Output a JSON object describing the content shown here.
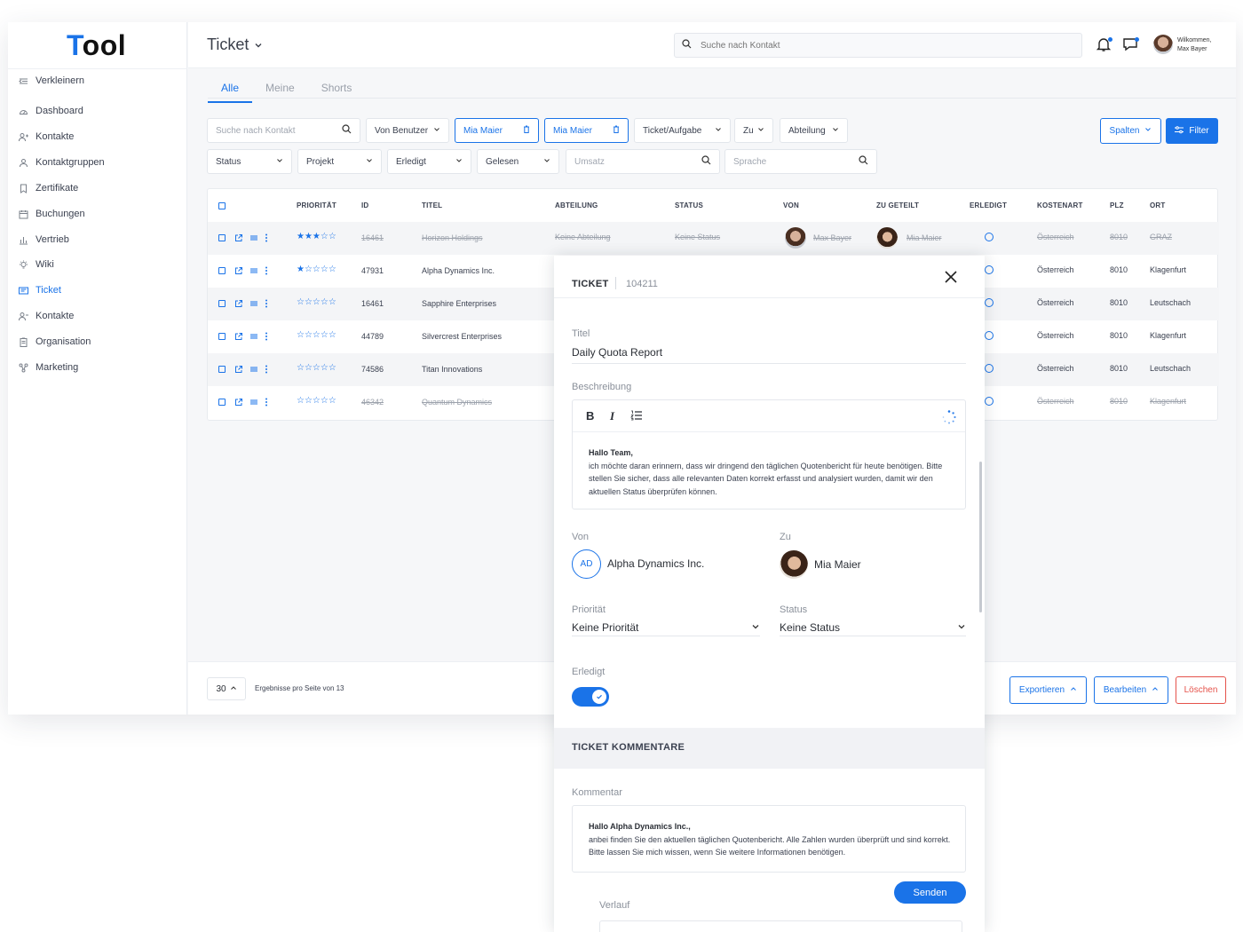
{
  "app": {
    "logo_first": "T",
    "logo_rest": "ool"
  },
  "sidebar": {
    "items": [
      {
        "label": "Verkleinern",
        "icon": "collapse-icon"
      },
      {
        "label": "Dashboard",
        "icon": "dashboard-icon"
      },
      {
        "label": "Kontakte",
        "icon": "contacts-icon"
      },
      {
        "label": "Kontaktgruppen",
        "icon": "contact-groups-icon"
      },
      {
        "label": "Zertifikate",
        "icon": "bookmark-icon"
      },
      {
        "label": "Buchungen",
        "icon": "calendar-icon"
      },
      {
        "label": "Vertrieb",
        "icon": "bar-chart-icon"
      },
      {
        "label": "Wiki",
        "icon": "lightbulb-icon"
      },
      {
        "label": "Ticket",
        "icon": "ticket-icon",
        "active": true
      },
      {
        "label": "Kontakte",
        "icon": "contacts-icon"
      },
      {
        "label": "Organisation",
        "icon": "clipboard-icon"
      },
      {
        "label": "Marketing",
        "icon": "network-icon"
      }
    ]
  },
  "header": {
    "title": "Ticket",
    "search_placeholder": "Suche nach Kontakt",
    "welcome": "Wilkommen,",
    "user_name": "Max Bayer"
  },
  "tabs": [
    "Alle",
    "Meine",
    "Shorts"
  ],
  "filters": {
    "row1": {
      "contact_search": "Suche nach Kontakt",
      "von_benutzer": "Von Benutzer",
      "chip1": "Mia Maier",
      "chip2": "Mia Maier",
      "ticket_aufgabe": "Ticket/Aufgabe",
      "zu": "Zu",
      "abteilung": "Abteilung",
      "spalten": "Spalten",
      "filter": "Filter"
    },
    "row2": {
      "status": "Status",
      "projekt": "Projekt",
      "erledigt": "Erledigt",
      "gelesen": "Gelesen",
      "umsatz": "Umsatz",
      "sprache": "Sprache"
    }
  },
  "table": {
    "headers": [
      "PRIORITÄT",
      "ID",
      "TITEL",
      "ABTEILUNG",
      "STATUS",
      "VON",
      "ZU GETEILT",
      "ERLEDIGT",
      "KOSTENART",
      "PLZ",
      "ORT"
    ],
    "rows": [
      {
        "stars": "★★★☆☆",
        "id": "16461",
        "title": "Horizon Holdings",
        "abteilung": "Keine Abteilung",
        "status": "Keine Status",
        "von": "Max Bayer",
        "zu": "Mia Maier",
        "kostenart": "Österreich",
        "plz": "8010",
        "ort": "GRAZ",
        "strike": true
      },
      {
        "stars": "★☆☆☆☆",
        "id": "47931",
        "title": "Alpha Dynamics Inc.",
        "kostenart": "Österreich",
        "plz": "8010",
        "ort": "Klagenfurt",
        "strike": false
      },
      {
        "stars": "☆☆☆☆☆",
        "id": "16461",
        "title": "Sapphire Enterprises",
        "kostenart": "Österreich",
        "plz": "8010",
        "ort": "Leutschach",
        "strike": false
      },
      {
        "stars": "☆☆☆☆☆",
        "id": "44789",
        "title": "Silvercrest Enterprises",
        "kostenart": "Österreich",
        "plz": "8010",
        "ort": "Klagenfurt",
        "strike": false
      },
      {
        "stars": "☆☆☆☆☆",
        "id": "74586",
        "title": "Titan Innovations",
        "kostenart": "Österreich",
        "plz": "8010",
        "ort": "Leutschach",
        "strike": false
      },
      {
        "stars": "☆☆☆☆☆",
        "id": "46342",
        "title": "Quantum Dynamics",
        "kostenart": "Österreich",
        "plz": "8010",
        "ort": "Klagenfurt",
        "strike": true
      }
    ]
  },
  "footer": {
    "page_size": "30",
    "pager_text": "Ergebnisse pro Seite von 13",
    "export": "Exportieren",
    "edit": "Bearbeiten",
    "delete": "Löschen"
  },
  "panel": {
    "heading": "TICKET",
    "ticket_id": "104211",
    "titel_label": "Titel",
    "titel_value": "Daily Quota Report",
    "beschreibung_label": "Beschreibung",
    "desc_greeting": "Hallo Team,",
    "desc_body": "ich möchte daran erinnern, dass wir dringend den täglichen Quotenbericht für heute benötigen. Bitte stellen Sie sicher, dass alle relevanten Daten korrekt erfasst und analysiert wurden, damit wir den aktuellen Status überprüfen können.",
    "von_label": "Von",
    "von_initials": "AD",
    "von_name": "Alpha Dynamics Inc.",
    "zu_label": "Zu",
    "zu_name": "Mia Maier",
    "prioritaet_label": "Priorität",
    "prioritaet_value": "Keine Priorität",
    "status_label": "Status",
    "status_value": "Keine Status",
    "erledigt_label": "Erledigt",
    "erledigt_on": true,
    "comments_heading": "TICKET KOMMENTARE",
    "kommentar_label": "Kommentar",
    "comment_greeting": "Hallo Alpha Dynamics Inc.,",
    "comment_body": "anbei finden Sie den aktuellen täglichen Quotenbericht. Alle Zahlen wurden überprüft und sind korrekt. Bitte lassen Sie mich wissen, wenn Sie weitere Informationen benötigen.",
    "send": "Senden",
    "verlauf_label": "Verlauf"
  },
  "colors": {
    "accent": "#1a73e8",
    "danger": "#e5534b"
  }
}
